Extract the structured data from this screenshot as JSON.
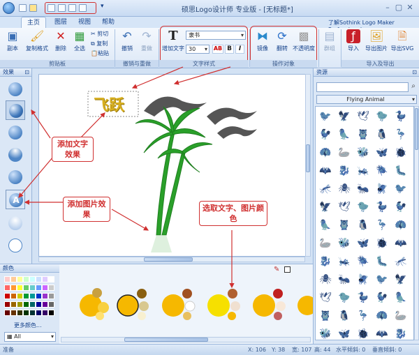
{
  "window": {
    "title": "硕思Logo设计师 专业版 - [无标题*]",
    "controls": [
      "–",
      "▢",
      "✕"
    ]
  },
  "tabs": [
    "主页",
    "图层",
    "视图",
    "帮助"
  ],
  "help_link": "了解Sothink Logo Maker Professional",
  "ribbon": {
    "clipboard": {
      "buttons": [
        "副本",
        "复制格式",
        "删除",
        "全选"
      ],
      "small": [
        "剪切",
        "复制",
        "粘贴"
      ],
      "label": "剪贴板"
    },
    "undo": {
      "buttons": [
        "撤销",
        "重做"
      ],
      "label": "撤销与重做"
    },
    "text": {
      "add_label": "增加文字",
      "font": "隶书",
      "size": "30",
      "label": "文字样式"
    },
    "object": {
      "buttons": [
        "镜像",
        "翻转",
        "不透明度"
      ],
      "label": "操作对象"
    },
    "group": {
      "buttons": [
        "群组"
      ]
    },
    "io": {
      "buttons": [
        "导入",
        "导出图片",
        "导出SVG"
      ],
      "label": "导入及导出"
    }
  },
  "left_panel": {
    "title": "效果"
  },
  "canvas": {
    "logo_text": "飞跃"
  },
  "callouts": {
    "text_effect": "添加文字效果",
    "image_effect": "添加图片效果",
    "select_color": "选取文字、图片颜色"
  },
  "resources": {
    "title": "资源",
    "search_placeholder": "",
    "category": "Flying Animal"
  },
  "colors": {
    "title": "颜色",
    "more": "更多颜色...",
    "filter": "All"
  },
  "status": {
    "ready": "准备",
    "x": "X: 106",
    "y": "Y: 38",
    "w": "宽: 107",
    "h": "高: 44",
    "hs": "水平倾斜: 0",
    "vs": "垂直倾斜: 0"
  },
  "palette": [
    "#ffcccc",
    "#ffcc99",
    "#ffff99",
    "#ccffcc",
    "#ccffff",
    "#cce0ff",
    "#e0ccff",
    "#ffffff",
    "#ff6666",
    "#ff9933",
    "#ffff33",
    "#66cc66",
    "#66cccc",
    "#6699ff",
    "#cc66ff",
    "#cccccc",
    "#cc0000",
    "#cc6600",
    "#cccc00",
    "#009933",
    "#009999",
    "#0033cc",
    "#9933cc",
    "#999999",
    "#990000",
    "#996600",
    "#999900",
    "#006600",
    "#006666",
    "#000099",
    "#660099",
    "#666666",
    "#660000",
    "#663300",
    "#333300",
    "#003300",
    "#003333",
    "#000066",
    "#330066",
    "#000000"
  ],
  "animals": [
    "🐦",
    "🦅",
    "🕊",
    "🐤",
    "🦆",
    "🐓",
    "🦜",
    "🦉",
    "🐧",
    "🦩",
    "🦚",
    "🦢",
    "🐝",
    "🦋",
    "🐞",
    "🦇",
    "🐉",
    "🦗",
    "🪲",
    "🐛",
    "🦟",
    "🕷",
    "🐜",
    "🪰"
  ]
}
